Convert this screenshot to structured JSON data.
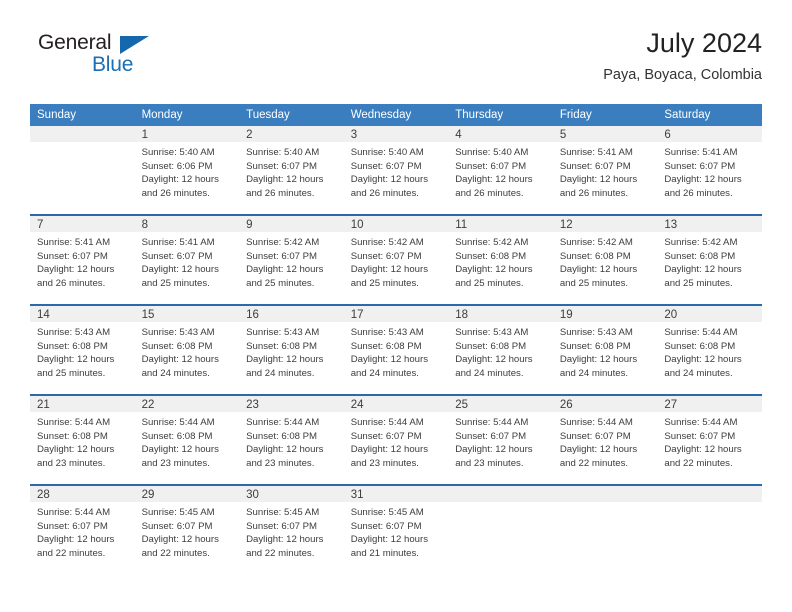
{
  "brand": {
    "name_part1": "General",
    "name_part2": "Blue",
    "logo_icon": "triangle-logo-icon",
    "accent_color": "#1668ac"
  },
  "header": {
    "title": "July 2024",
    "subtitle": "Paya, Boyaca, Colombia"
  },
  "calendar": {
    "header_color": "#3a7ebf",
    "separator_color": "#2a6aab",
    "daynum_band_color": "#f0f0f0",
    "weekday_headers": [
      "Sunday",
      "Monday",
      "Tuesday",
      "Wednesday",
      "Thursday",
      "Friday",
      "Saturday"
    ],
    "weeks": [
      [
        {
          "day": "",
          "lines": []
        },
        {
          "day": "1",
          "lines": [
            "Sunrise: 5:40 AM",
            "Sunset: 6:06 PM",
            "Daylight: 12 hours",
            "and 26 minutes."
          ]
        },
        {
          "day": "2",
          "lines": [
            "Sunrise: 5:40 AM",
            "Sunset: 6:07 PM",
            "Daylight: 12 hours",
            "and 26 minutes."
          ]
        },
        {
          "day": "3",
          "lines": [
            "Sunrise: 5:40 AM",
            "Sunset: 6:07 PM",
            "Daylight: 12 hours",
            "and 26 minutes."
          ]
        },
        {
          "day": "4",
          "lines": [
            "Sunrise: 5:40 AM",
            "Sunset: 6:07 PM",
            "Daylight: 12 hours",
            "and 26 minutes."
          ]
        },
        {
          "day": "5",
          "lines": [
            "Sunrise: 5:41 AM",
            "Sunset: 6:07 PM",
            "Daylight: 12 hours",
            "and 26 minutes."
          ]
        },
        {
          "day": "6",
          "lines": [
            "Sunrise: 5:41 AM",
            "Sunset: 6:07 PM",
            "Daylight: 12 hours",
            "and 26 minutes."
          ]
        }
      ],
      [
        {
          "day": "7",
          "lines": [
            "Sunrise: 5:41 AM",
            "Sunset: 6:07 PM",
            "Daylight: 12 hours",
            "and 26 minutes."
          ]
        },
        {
          "day": "8",
          "lines": [
            "Sunrise: 5:41 AM",
            "Sunset: 6:07 PM",
            "Daylight: 12 hours",
            "and 25 minutes."
          ]
        },
        {
          "day": "9",
          "lines": [
            "Sunrise: 5:42 AM",
            "Sunset: 6:07 PM",
            "Daylight: 12 hours",
            "and 25 minutes."
          ]
        },
        {
          "day": "10",
          "lines": [
            "Sunrise: 5:42 AM",
            "Sunset: 6:07 PM",
            "Daylight: 12 hours",
            "and 25 minutes."
          ]
        },
        {
          "day": "11",
          "lines": [
            "Sunrise: 5:42 AM",
            "Sunset: 6:08 PM",
            "Daylight: 12 hours",
            "and 25 minutes."
          ]
        },
        {
          "day": "12",
          "lines": [
            "Sunrise: 5:42 AM",
            "Sunset: 6:08 PM",
            "Daylight: 12 hours",
            "and 25 minutes."
          ]
        },
        {
          "day": "13",
          "lines": [
            "Sunrise: 5:42 AM",
            "Sunset: 6:08 PM",
            "Daylight: 12 hours",
            "and 25 minutes."
          ]
        }
      ],
      [
        {
          "day": "14",
          "lines": [
            "Sunrise: 5:43 AM",
            "Sunset: 6:08 PM",
            "Daylight: 12 hours",
            "and 25 minutes."
          ]
        },
        {
          "day": "15",
          "lines": [
            "Sunrise: 5:43 AM",
            "Sunset: 6:08 PM",
            "Daylight: 12 hours",
            "and 24 minutes."
          ]
        },
        {
          "day": "16",
          "lines": [
            "Sunrise: 5:43 AM",
            "Sunset: 6:08 PM",
            "Daylight: 12 hours",
            "and 24 minutes."
          ]
        },
        {
          "day": "17",
          "lines": [
            "Sunrise: 5:43 AM",
            "Sunset: 6:08 PM",
            "Daylight: 12 hours",
            "and 24 minutes."
          ]
        },
        {
          "day": "18",
          "lines": [
            "Sunrise: 5:43 AM",
            "Sunset: 6:08 PM",
            "Daylight: 12 hours",
            "and 24 minutes."
          ]
        },
        {
          "day": "19",
          "lines": [
            "Sunrise: 5:43 AM",
            "Sunset: 6:08 PM",
            "Daylight: 12 hours",
            "and 24 minutes."
          ]
        },
        {
          "day": "20",
          "lines": [
            "Sunrise: 5:44 AM",
            "Sunset: 6:08 PM",
            "Daylight: 12 hours",
            "and 24 minutes."
          ]
        }
      ],
      [
        {
          "day": "21",
          "lines": [
            "Sunrise: 5:44 AM",
            "Sunset: 6:08 PM",
            "Daylight: 12 hours",
            "and 23 minutes."
          ]
        },
        {
          "day": "22",
          "lines": [
            "Sunrise: 5:44 AM",
            "Sunset: 6:08 PM",
            "Daylight: 12 hours",
            "and 23 minutes."
          ]
        },
        {
          "day": "23",
          "lines": [
            "Sunrise: 5:44 AM",
            "Sunset: 6:08 PM",
            "Daylight: 12 hours",
            "and 23 minutes."
          ]
        },
        {
          "day": "24",
          "lines": [
            "Sunrise: 5:44 AM",
            "Sunset: 6:07 PM",
            "Daylight: 12 hours",
            "and 23 minutes."
          ]
        },
        {
          "day": "25",
          "lines": [
            "Sunrise: 5:44 AM",
            "Sunset: 6:07 PM",
            "Daylight: 12 hours",
            "and 23 minutes."
          ]
        },
        {
          "day": "26",
          "lines": [
            "Sunrise: 5:44 AM",
            "Sunset: 6:07 PM",
            "Daylight: 12 hours",
            "and 22 minutes."
          ]
        },
        {
          "day": "27",
          "lines": [
            "Sunrise: 5:44 AM",
            "Sunset: 6:07 PM",
            "Daylight: 12 hours",
            "and 22 minutes."
          ]
        }
      ],
      [
        {
          "day": "28",
          "lines": [
            "Sunrise: 5:44 AM",
            "Sunset: 6:07 PM",
            "Daylight: 12 hours",
            "and 22 minutes."
          ]
        },
        {
          "day": "29",
          "lines": [
            "Sunrise: 5:45 AM",
            "Sunset: 6:07 PM",
            "Daylight: 12 hours",
            "and 22 minutes."
          ]
        },
        {
          "day": "30",
          "lines": [
            "Sunrise: 5:45 AM",
            "Sunset: 6:07 PM",
            "Daylight: 12 hours",
            "and 22 minutes."
          ]
        },
        {
          "day": "31",
          "lines": [
            "Sunrise: 5:45 AM",
            "Sunset: 6:07 PM",
            "Daylight: 12 hours",
            "and 21 minutes."
          ]
        },
        {
          "day": "",
          "lines": []
        },
        {
          "day": "",
          "lines": []
        },
        {
          "day": "",
          "lines": []
        }
      ]
    ]
  }
}
